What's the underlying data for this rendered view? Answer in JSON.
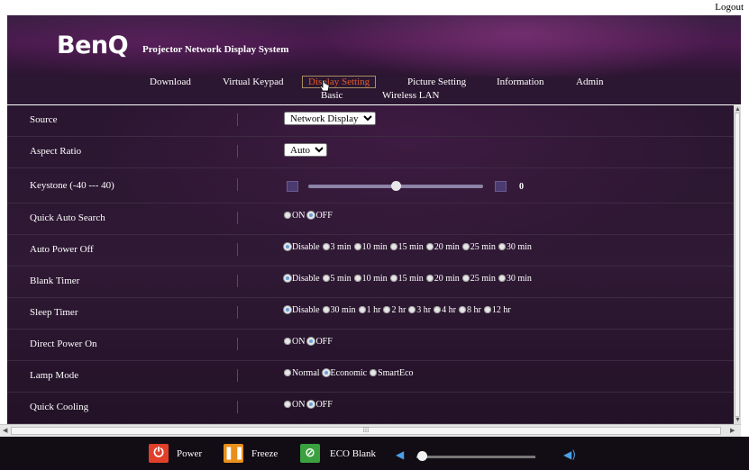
{
  "top": {
    "logout": "Logout"
  },
  "header": {
    "logo": "BenQ",
    "system_name": "Projector Network Display System"
  },
  "nav": {
    "tabs": [
      {
        "label": "Download"
      },
      {
        "label": "Virtual Keypad"
      },
      {
        "label": "Display Setting",
        "active": true
      },
      {
        "label": "Picture Setting"
      },
      {
        "label": "Information"
      },
      {
        "label": "Admin"
      }
    ],
    "subtabs": [
      {
        "label": "Basic"
      },
      {
        "label": "Wireless LAN"
      }
    ]
  },
  "settings": {
    "source": {
      "label": "Source",
      "value": "Network Display"
    },
    "aspect": {
      "label": "Aspect Ratio",
      "value": "Auto"
    },
    "keystone": {
      "label": "Keystone (-40 --- 40)",
      "value": "0",
      "level_fraction": 0.5
    },
    "quick_auto_search": {
      "label": "Quick Auto Search",
      "options": [
        "ON",
        "OFF"
      ],
      "selected": "OFF"
    },
    "auto_power_off": {
      "label": "Auto Power Off",
      "options": [
        "Disable",
        "3 min",
        "10 min",
        "15 min",
        "20 min",
        "25 min",
        "30 min"
      ],
      "selected": "Disable"
    },
    "blank_timer": {
      "label": "Blank Timer",
      "options": [
        "Disable",
        "5 min",
        "10 min",
        "15 min",
        "20 min",
        "25 min",
        "30 min"
      ],
      "selected": "Disable"
    },
    "sleep_timer": {
      "label": "Sleep Timer",
      "options": [
        "Disable",
        "30 min",
        "1 hr",
        "2 hr",
        "3 hr",
        "4 hr",
        "8 hr",
        "12 hr"
      ],
      "selected": "Disable"
    },
    "direct_power_on": {
      "label": "Direct Power On",
      "options": [
        "ON",
        "OFF"
      ],
      "selected": "OFF"
    },
    "lamp_mode": {
      "label": "Lamp Mode",
      "options": [
        "Normal",
        "Economic",
        "SmartEco"
      ],
      "selected": "Economic"
    },
    "quick_cooling": {
      "label": "Quick Cooling",
      "options": [
        "ON",
        "OFF"
      ],
      "selected": "OFF"
    }
  },
  "bottom": {
    "power": {
      "label": "Power",
      "icon": "power-icon",
      "color": "#e0402a"
    },
    "freeze": {
      "label": "Freeze",
      "icon": "freeze-icon",
      "color": "#e8901a"
    },
    "eco_blank": {
      "label": "ECO Blank",
      "icon": "eco-blank-icon",
      "color": "#3aa040"
    },
    "volume_fraction": 0.0
  },
  "colors": {
    "active_tab": "#e05a2a",
    "radio_selected": "#6aa0d8"
  }
}
